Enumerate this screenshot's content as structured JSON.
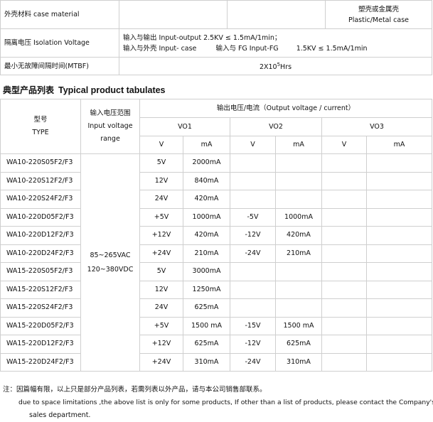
{
  "spec": {
    "case_material": {
      "label": "外壳材料 case material",
      "value_cn": "塑壳或金属壳",
      "value_en": "Plastic/Metal case"
    },
    "isolation": {
      "label": "隔离电压 Isolation Voltage",
      "line1": "输入与输出 Input-output 2.5KV ≤ 1.5mA/1min；",
      "line2a": "输入与外壳 Input- case",
      "line2b": "输入与 FG Input-FG",
      "line2c": "1.5KV ≤ 1.5mA/1min"
    },
    "mtbf": {
      "label": "最小无故障间隔时间(MTBF)",
      "base": "2X10",
      "exp": "5",
      "unit": "Hrs"
    }
  },
  "section": {
    "title_cn": "典型产品列表",
    "title_en": "Typical product tabulates"
  },
  "table": {
    "type_cn": "型号",
    "type_en": "TYPE",
    "input_cn": "输入电压范围",
    "input_en": "Input voltage",
    "input_en2": "range",
    "output_header": "输出电压/电流（Output voltage / current）",
    "vo1": "VO1",
    "vo2": "VO2",
    "vo3": "VO3",
    "v": "V",
    "ma": "mA",
    "range1": "85~265VAC",
    "range2": "120~380VDC",
    "rows": [
      {
        "model": "WA10-220S05F2/F3",
        "v1": "5V",
        "a1": "2000mA",
        "v2": "",
        "a2": ""
      },
      {
        "model": "WA10-220S12F2/F3",
        "v1": "12V",
        "a1": "840mA",
        "v2": "",
        "a2": ""
      },
      {
        "model": "WA10-220S24F2/F3",
        "v1": "24V",
        "a1": "420mA",
        "v2": "",
        "a2": ""
      },
      {
        "model": "WA10-220D05F2/F3",
        "v1": "+5V",
        "a1": "1000mA",
        "v2": "-5V",
        "a2": "1000mA"
      },
      {
        "model": "WA10-220D12F2/F3",
        "v1": "+12V",
        "a1": "420mA",
        "v2": "-12V",
        "a2": "420mA"
      },
      {
        "model": "WA10-220D24F2/F3",
        "v1": "+24V",
        "a1": "210mA",
        "v2": "-24V",
        "a2": "210mA"
      },
      {
        "model": "WA15-220S05F2/F3",
        "v1": "5V",
        "a1": "3000mA",
        "v2": "",
        "a2": ""
      },
      {
        "model": "WA15-220S12F2/F3",
        "v1": "12V",
        "a1": "1250mA",
        "v2": "",
        "a2": ""
      },
      {
        "model": "WA15-220S24F2/F3",
        "v1": "24V",
        "a1": "625mA",
        "v2": "",
        "a2": ""
      },
      {
        "model": "WA15-220D05F2/F3",
        "v1": "+5V",
        "a1": "1500 mA",
        "v2": "-15V",
        "a2": "1500 mA"
      },
      {
        "model": "WA15-220D12F2/F3",
        "v1": "+12V",
        "a1": "625mA",
        "v2": "-12V",
        "a2": "625mA"
      },
      {
        "model": "WA15-220D24F2/F3",
        "v1": "+24V",
        "a1": "310mA",
        "v2": "-24V",
        "a2": "310mA"
      }
    ]
  },
  "note": {
    "cn": "注：因篇幅有限，以上只是部分产品列表，若需列表以外产品，请与本公司销售部联系。",
    "en1": "due to space limitations ,the above list is only for some products, If other than a list of products, please contact the Company's",
    "en2": "sales department."
  }
}
